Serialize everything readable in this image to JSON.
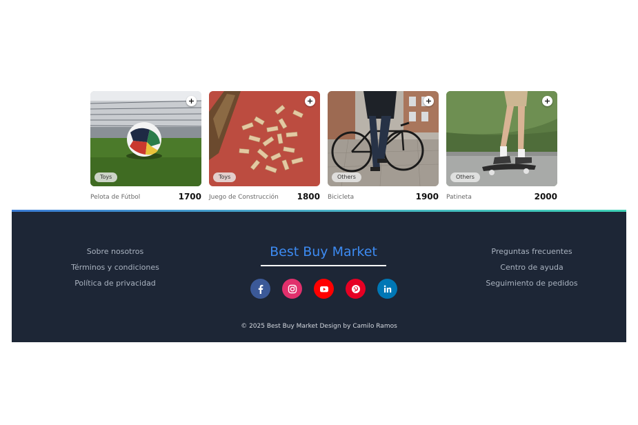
{
  "products": [
    {
      "name": "Pelota de Fútbol",
      "price": "1700",
      "category": "Toys",
      "image": "soccer-ball-photo"
    },
    {
      "name": "Juego de Construcción",
      "price": "1800",
      "category": "Toys",
      "image": "wooden-blocks-photo"
    },
    {
      "name": "Bicicleta",
      "price": "1900",
      "category": "Others",
      "image": "bicycle-photo"
    },
    {
      "name": "Patineta",
      "price": "2000",
      "category": "Others",
      "image": "skateboard-photo"
    }
  ],
  "add_icon": "plus-icon",
  "footer": {
    "left_links": [
      "Sobre nosotros",
      "Términos y condiciones",
      "Política de privacidad"
    ],
    "brand": "Best Buy Market",
    "right_links": [
      "Preguntas frecuentes",
      "Centro de ayuda",
      "Seguimiento de pedidos"
    ],
    "socials": [
      {
        "name": "facebook-icon",
        "color": "#3b5998"
      },
      {
        "name": "instagram-icon",
        "color": "#e1306c"
      },
      {
        "name": "youtube-icon",
        "color": "#ff0000"
      },
      {
        "name": "pinterest-icon",
        "color": "#e60023"
      },
      {
        "name": "linkedin-icon",
        "color": "#0077b5"
      }
    ],
    "copyright": "© 2025 Best Buy Market Design by Camilo Ramos"
  },
  "colors": {
    "footer_bg": "#1d2636",
    "brand_blue": "#3d8bf2",
    "accent_gradient": [
      "#3a7bd5",
      "#3ed1b6"
    ]
  }
}
